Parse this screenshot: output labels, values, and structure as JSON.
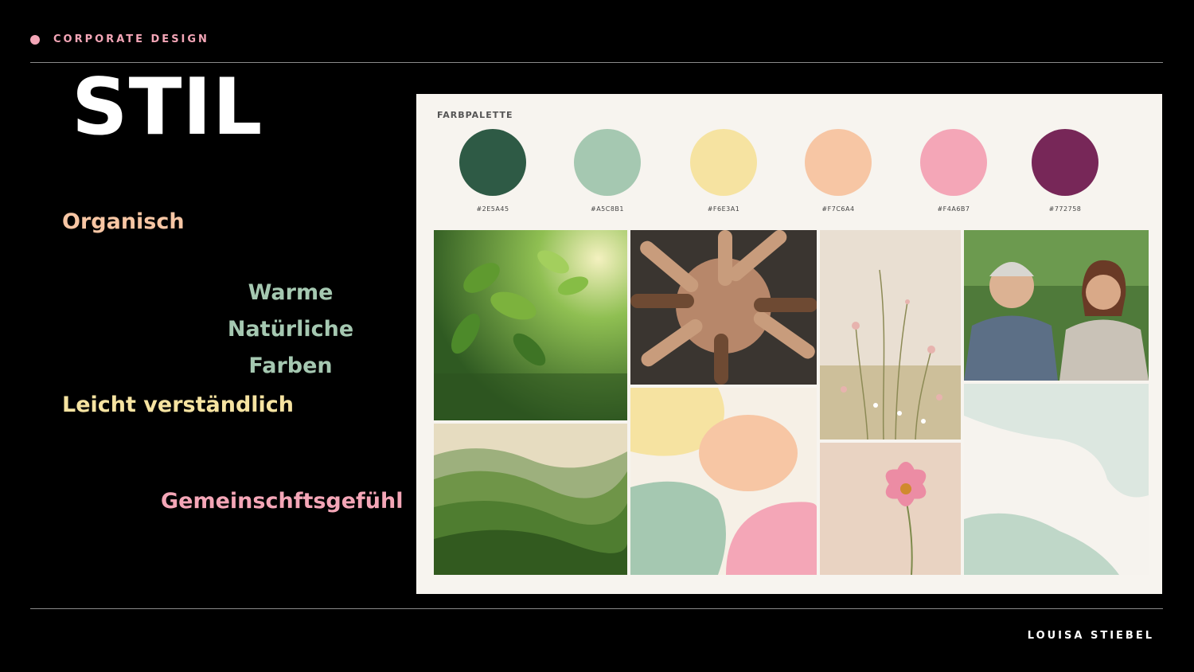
{
  "header": {
    "label": "CORPORATE DESIGN"
  },
  "title": "STIL",
  "keywords": {
    "k1": "Organisch",
    "k2_line1": "Warme Natürliche",
    "k2_line2": "Farben",
    "k3": "Leicht verständlich",
    "k4": "Gemeinschftsgefühl"
  },
  "footer": {
    "name": "LOUISA STIEBEL"
  },
  "moodboard": {
    "palette_title": "FARBPALETTE",
    "swatches": [
      {
        "hex": "#2E5A45",
        "color": "#2E5A45"
      },
      {
        "hex": "#A5C8B1",
        "color": "#A5C8B1"
      },
      {
        "hex": "#F6E3A1",
        "color": "#F6E3A1"
      },
      {
        "hex": "#F7C6A4",
        "color": "#F7C6A4"
      },
      {
        "hex": "#F4A6B7",
        "color": "#F4A6B7"
      },
      {
        "hex": "#772758",
        "color": "#772758"
      }
    ]
  }
}
